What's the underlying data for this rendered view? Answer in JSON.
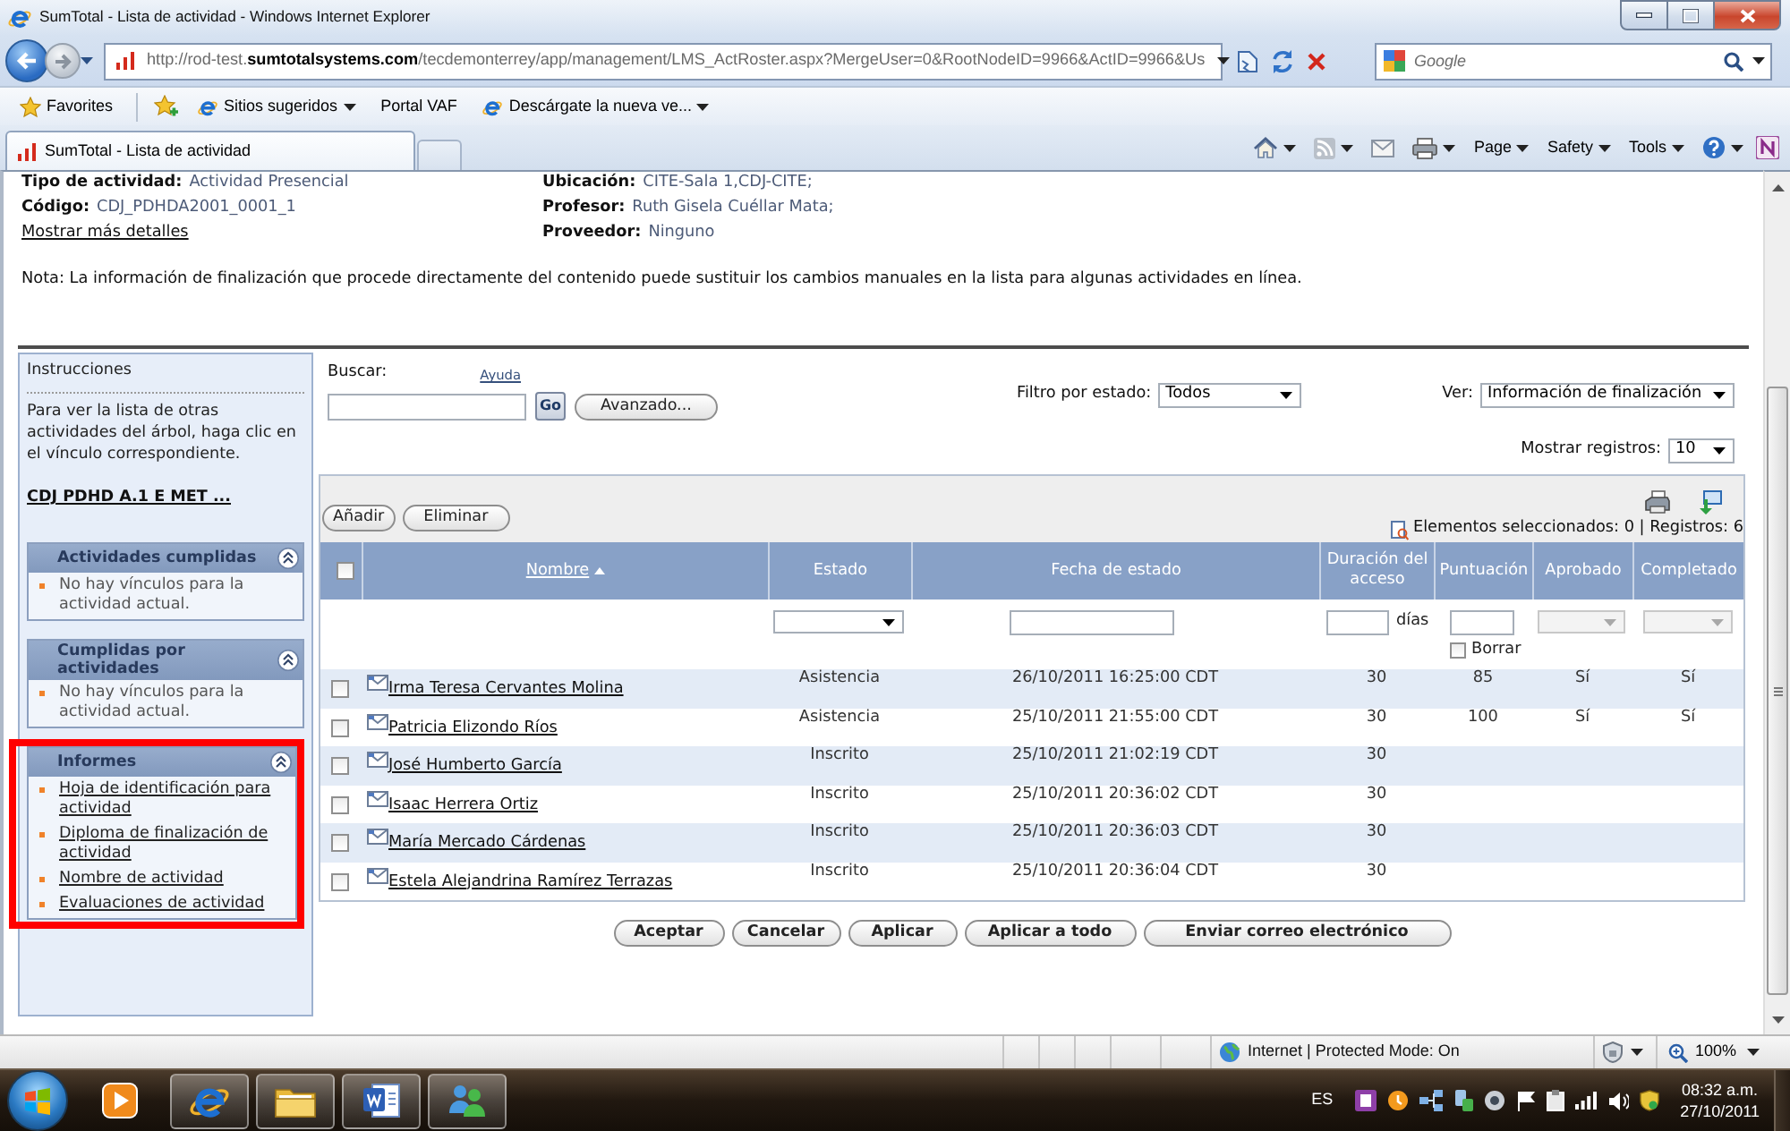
{
  "window": {
    "title": "SumTotal - Lista de actividad - Windows Internet Explorer"
  },
  "address_bar": {
    "back_enabled": true,
    "forward_enabled": false,
    "url": "http://rod-test.**sumtotalsystems.com**/tecdemonterrey/app/management/LMS_ActRoster.aspx?MergeUser=0&RootNodeID=9966&ActID=9966&Us",
    "search_placeholder": "Google"
  },
  "favorites_bar": {
    "favorites_label": "Favorites",
    "items": [
      {
        "label": "Sitios sugeridos",
        "icon": true,
        "dropdown": true
      },
      {
        "label": "Portal VAF",
        "icon": false,
        "dropdown": false
      },
      {
        "label": "Descárgate la nueva ve...",
        "icon": true,
        "dropdown": true
      }
    ]
  },
  "tabs": [
    {
      "label": "SumTotal - Lista de actividad",
      "selected": true
    }
  ],
  "command_bar": {
    "menus": [
      "Page",
      "Safety",
      "Tools"
    ]
  },
  "activity": {
    "fields_left": [
      {
        "label": "Tipo de actividad:",
        "value": "Actividad Presencial"
      },
      {
        "label": "Código:",
        "value": "CDJ_PDHDA2001_0001_1"
      }
    ],
    "details_link": "Mostrar más detalles",
    "fields_right": [
      {
        "label": "Ubicación:",
        "value": "CITE-Sala 1,CDJ-CITE;"
      },
      {
        "label": "Profesor:",
        "value": "Ruth Gisela Cuéllar Mata;"
      },
      {
        "label": "Proveedor:",
        "value": "Ninguno"
      }
    ]
  },
  "note": "Nota: La información de finalización que procede directamente del contenido puede sustituir los cambios manuales en la lista para algunas actividades en línea.",
  "sidebar": {
    "title": "Instrucciones",
    "text": "Para ver la lista de otras actividades del árbol, haga clic en el vínculo correspondiente.",
    "tree_link": "CDJ PDHD A.1 E MET ...",
    "panels": [
      {
        "title": "Actividades cumplidas",
        "expanded": true,
        "highlighted": false,
        "items": [
          {
            "kind": "text",
            "label": "No hay vínculos para la actividad actual."
          }
        ]
      },
      {
        "title": "Cumplidas por actividades",
        "expanded": true,
        "highlighted": false,
        "items": [
          {
            "kind": "text",
            "label": "No hay vínculos para la actividad actual."
          }
        ]
      },
      {
        "title": "Informes",
        "expanded": true,
        "highlighted": true,
        "items": [
          {
            "kind": "link",
            "label": "Hoja de identificación para actividad"
          },
          {
            "kind": "link",
            "label": "Diploma de finalización de actividad"
          },
          {
            "kind": "link",
            "label": "Nombre de actividad"
          },
          {
            "kind": "link",
            "label": "Evaluaciones de actividad"
          }
        ]
      }
    ]
  },
  "search": {
    "label": "Buscar:",
    "help_link": "Ayuda",
    "go_button": "Go",
    "advanced_button": "Avanzado..."
  },
  "status_filter": {
    "label": "Filtro por estado:",
    "value": "Todos"
  },
  "view_select": {
    "label": "Ver:",
    "value": "Información de finalización"
  },
  "page_size": {
    "label": "Mostrar registros:",
    "value": "10"
  },
  "grid": {
    "buttons": [
      "Añadir",
      "Eliminar"
    ],
    "summary": "Elementos seleccionados: 0 | Registros: 6",
    "select_all": false,
    "columns": [
      {
        "label": "Nombre",
        "link": true,
        "sorted": true
      },
      {
        "label": "Estado",
        "link": false,
        "sorted": false,
        "filter": {
          "kind": "select",
          "disabled": false
        }
      },
      {
        "label": "Fecha de estado",
        "link": false,
        "sorted": false,
        "filter": {
          "kind": "input"
        }
      },
      {
        "label": "Duración del acceso",
        "link": false,
        "sorted": false,
        "filter": {
          "kind": "input",
          "unit": "días"
        }
      },
      {
        "label": "Puntuación",
        "link": false,
        "sorted": false,
        "filter": {
          "kind": "input",
          "clear_label": "Borrar",
          "clear_checked": false
        }
      },
      {
        "label": "Aprobado",
        "link": false,
        "sorted": false,
        "filter": {
          "kind": "select",
          "disabled": true
        }
      },
      {
        "label": "Completado",
        "link": false,
        "sorted": false,
        "filter": {
          "kind": "select",
          "disabled": true
        }
      }
    ],
    "rows": [
      {
        "checked": false,
        "cells": [
          "Irma Teresa Cervantes Molina",
          "Asistencia",
          "26/10/2011 16:25:00 CDT",
          "30",
          "85",
          "Sí",
          "Sí"
        ]
      },
      {
        "checked": false,
        "cells": [
          "Patricia Elizondo Ríos",
          "Asistencia",
          "25/10/2011 21:55:00 CDT",
          "30",
          "100",
          "Sí",
          "Sí"
        ]
      },
      {
        "checked": false,
        "cells": [
          "José Humberto García",
          "Inscrito",
          "25/10/2011 21:02:19 CDT",
          "30"
        ]
      },
      {
        "checked": false,
        "cells": [
          "Isaac Herrera Ortiz",
          "Inscrito",
          "25/10/2011 20:36:02 CDT",
          "30"
        ]
      },
      {
        "checked": false,
        "cells": [
          "María Mercado Cárdenas",
          "Inscrito",
          "25/10/2011 20:36:03 CDT",
          "30"
        ]
      },
      {
        "checked": false,
        "cells": [
          "Estela Alejandrina Ramírez Terrazas",
          "Inscrito",
          "25/10/2011 20:36:04 CDT",
          "30"
        ]
      }
    ]
  },
  "actions": [
    "Aceptar",
    "Cancelar",
    "Aplicar",
    "Aplicar a todo",
    "Enviar correo electrónico"
  ],
  "status_bar": {
    "zone": "Internet | Protected Mode: On",
    "zoom": "100%"
  },
  "taskbar": {
    "apps": [
      {
        "kind": "media",
        "running": false
      },
      {
        "kind": "browser",
        "running": true
      },
      {
        "kind": "folder",
        "running": true
      },
      {
        "kind": "word",
        "running": true
      },
      {
        "kind": "messenger",
        "running": true
      }
    ],
    "language": "ES",
    "time": "08:32 a.m.",
    "date": "27/10/2011"
  }
}
